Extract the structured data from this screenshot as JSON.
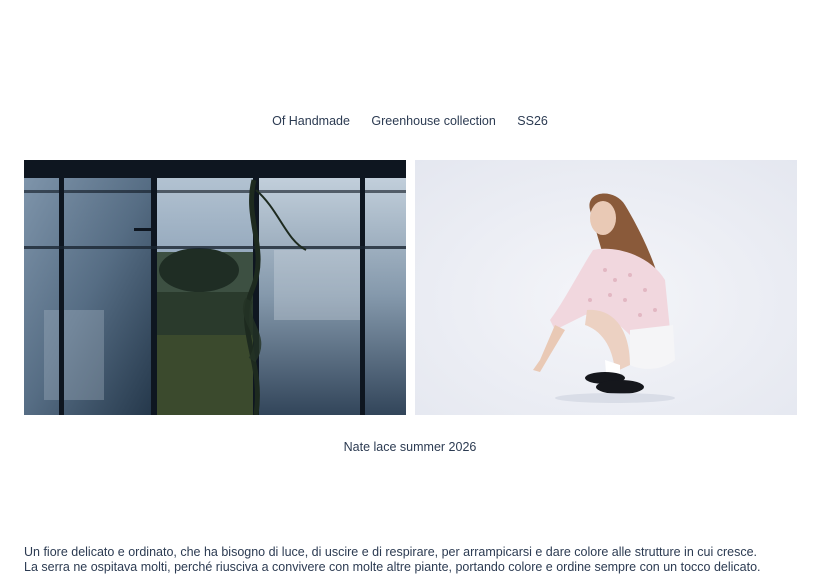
{
  "nav": {
    "brand": "Of Handmade",
    "collection": "Greenhouse collection",
    "season": "SS26"
  },
  "gallery": {
    "left_image": "greenhouse-photo",
    "right_image": "model-photo"
  },
  "caption": "Nate lace summer 2026",
  "description": {
    "line1": "Un fiore delicato e ordinato, che ha bisogno di luce, di uscire e di respirare, per arrampicarsi e dare colore alle strutture in cui cresce.",
    "line2": "La serra ne ospitava molti, perché riusciva a convivere con molte altre piante, portando colore e ordine sempre con un tocco delicato."
  }
}
